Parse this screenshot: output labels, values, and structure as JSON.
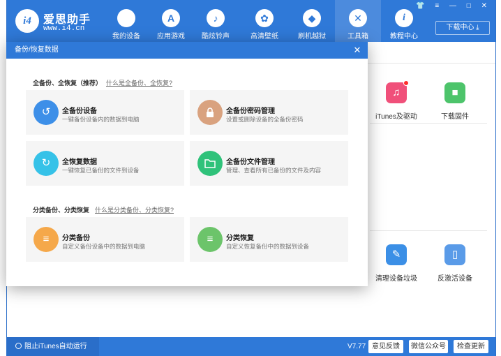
{
  "brand": {
    "logo_text": "i4",
    "name": "爱思助手",
    "url": "www.i4.cn"
  },
  "nav": [
    {
      "label": "我的设备",
      "icon": "apple-icon",
      "glyph": ""
    },
    {
      "label": "应用游戏",
      "icon": "app-store-icon",
      "glyph": "A"
    },
    {
      "label": "酷炫铃声",
      "icon": "bell-icon",
      "glyph": "♪"
    },
    {
      "label": "高清壁纸",
      "icon": "flower-icon",
      "glyph": "✿"
    },
    {
      "label": "刷机越狱",
      "icon": "dropbox-icon",
      "glyph": "◆"
    },
    {
      "label": "工具箱",
      "icon": "tools-icon",
      "glyph": "✕"
    },
    {
      "label": "教程中心",
      "icon": "info-icon",
      "glyph": "i"
    }
  ],
  "window_controls": "👕 ≡ — □ ✕",
  "download_center": {
    "label": "下载中心",
    "icon": "download-icon"
  },
  "background_tools": [
    {
      "label": "iTunes及驱动",
      "icon": "itunes-icon",
      "color": "#f0507a",
      "glyph": "♫",
      "badge": true
    },
    {
      "label": "下载固件",
      "icon": "cube-icon",
      "color": "#4dc46b",
      "glyph": "■"
    },
    {
      "label": "清理设备垃圾",
      "icon": "broom-icon",
      "color": "#3b8fe6",
      "glyph": "✎"
    },
    {
      "label": "反激活设备",
      "icon": "phone-icon",
      "color": "#5a9be8",
      "glyph": "▯"
    }
  ],
  "modal": {
    "title": "备份/恢复数据",
    "close": "✕",
    "sections": [
      {
        "title": "全备份、全恢复（推荐）",
        "link": "什么是全备份、全恢复?",
        "items": [
          {
            "title": "全备份设备",
            "desc": "一键备份设备内的数据到电脑",
            "icon": "backup-clock-icon",
            "color": "#3d8fe8",
            "glyph": "↺"
          },
          {
            "title": "全备份密码管理",
            "desc": "设置或删除设备的全备份密码",
            "icon": "lock-icon",
            "color": "#d9a27f",
            "glyph": "🔒"
          },
          {
            "title": "全恢复数据",
            "desc": "一键恢复已备份的文件到设备",
            "icon": "restore-clock-icon",
            "color": "#36c2e8",
            "glyph": "↻"
          },
          {
            "title": "全备份文件管理",
            "desc": "管理、查看所有已备份的文件及内容",
            "icon": "folder-icon",
            "color": "#2fc27a",
            "glyph": "▭"
          }
        ]
      },
      {
        "title": "分类备份、分类恢复",
        "link": "什么是分类备份、分类恢复?",
        "items": [
          {
            "title": "分类备份",
            "desc": "自定义备份设备中的数据到电脑",
            "icon": "category-backup-icon",
            "color": "#f5a84a",
            "glyph": "≡"
          },
          {
            "title": "分类恢复",
            "desc": "自定义恢复备份中的数据到设备",
            "icon": "category-restore-icon",
            "color": "#6cc46a",
            "glyph": "≡"
          }
        ]
      }
    ]
  },
  "status": {
    "itunes_toggle": "阻止iTunes自动运行",
    "version": "V7.77",
    "feedback": "意见反馈",
    "wechat": "微信公众号",
    "update": "检查更新"
  }
}
